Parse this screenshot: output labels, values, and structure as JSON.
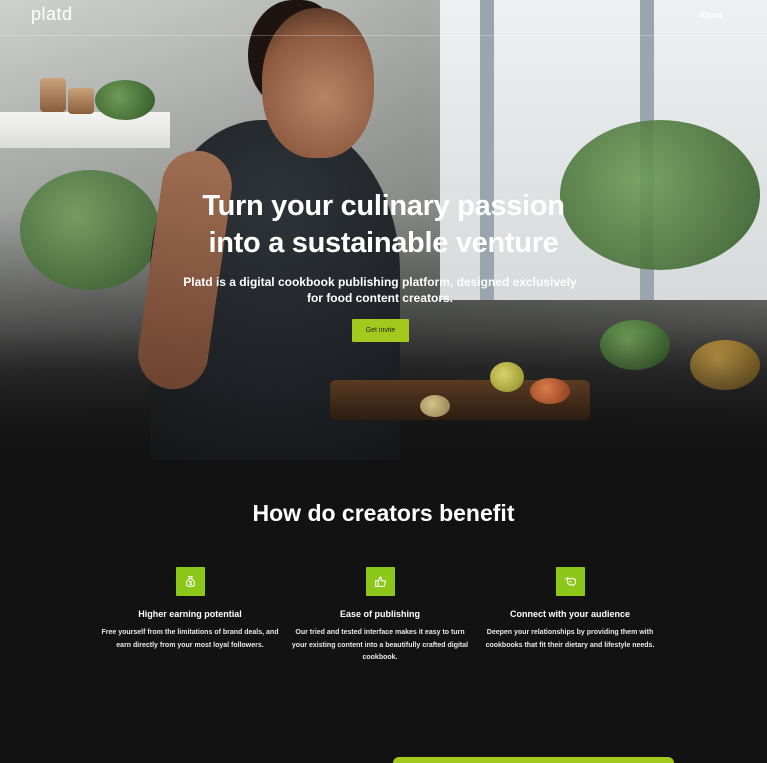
{
  "nav": {
    "logo": "platd",
    "about_label": "About"
  },
  "hero": {
    "title_line1": "Turn your culinary passion",
    "title_line2": "into a sustainable venture",
    "subtitle": "Platd is a digital cookbook publishing platform, designed exclusively for food content creators.",
    "cta_label": "Get invite"
  },
  "benefits": {
    "heading": "How do creators benefit",
    "items": [
      {
        "icon": "money-bag-icon",
        "title": "Higher earning potential",
        "description": "Free yourself from the limitations of brand deals, and earn directly from your most loyal followers."
      },
      {
        "icon": "thumbs-up-icon",
        "title": "Ease of publishing",
        "description": "Our tried and tested interface makes it easy to turn your existing content into a beautifully crafted digital cookbook."
      },
      {
        "icon": "handshake-icon",
        "title": "Connect with your audience",
        "description": "Deepen your relationships by providing them with cookbooks that fit their dietary and lifestyle needs."
      }
    ]
  },
  "colors": {
    "accent": "#a4c91e",
    "icon_bg": "#8cc81a",
    "background": "#121212"
  }
}
